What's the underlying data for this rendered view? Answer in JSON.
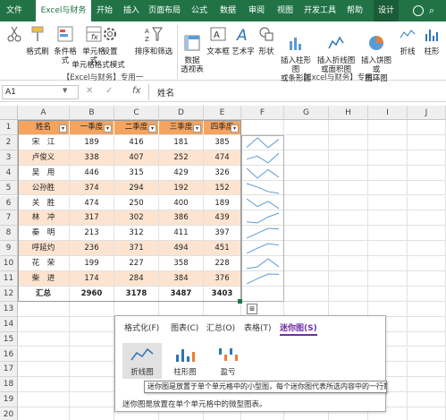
{
  "ribbon": {
    "tabs": [
      "文件",
      "Excel与财务",
      "开始",
      "插入",
      "页面布局",
      "公式",
      "数据",
      "审阅",
      "视图",
      "开发工具",
      "帮助",
      "设计"
    ],
    "active_tab": "Excel与财务",
    "design_tab": "设计",
    "buttons": {
      "format_brush": "格式刷",
      "cond_format": "条件格式",
      "cell_format": "单元格式",
      "settings": "设置",
      "sort_filter": "排序和筛选",
      "pivot": "数据\n透视表",
      "textbox": "文本框",
      "wordart": "艺术字",
      "shapes": "形状",
      "insert_bar": "插入柱形图\n或条形图",
      "insert_line": "插入折线图\n或面积图",
      "insert_pie": "插入饼图或\n圆环图",
      "line": "折线",
      "column": "柱形"
    },
    "group1": "【Excel与财务】专用一",
    "group2": "【Excel与财务】专用二",
    "group_cell_format": "单元格格式模式"
  },
  "formula_bar": {
    "name_box": "A1",
    "fx": "fx",
    "content": "姓名"
  },
  "columns": [
    "A",
    "B",
    "C",
    "D",
    "E",
    "F",
    "G",
    "H",
    "I",
    "J"
  ],
  "rows": [
    "1",
    "2",
    "3",
    "4",
    "5",
    "6",
    "7",
    "8",
    "9",
    "10",
    "11",
    "12",
    "13",
    "14",
    "15",
    "16",
    "17",
    "18",
    "19",
    "20"
  ],
  "table": {
    "headers": [
      "姓名",
      "一季度",
      "二季度",
      "三季度",
      "四季度"
    ],
    "data": [
      [
        "宋　江",
        "189",
        "416",
        "181",
        "385"
      ],
      [
        "卢俊义",
        "338",
        "407",
        "252",
        "474"
      ],
      [
        "吴　用",
        "446",
        "315",
        "429",
        "326"
      ],
      [
        "公孙胜",
        "374",
        "294",
        "192",
        "152"
      ],
      [
        "关　胜",
        "474",
        "250",
        "400",
        "189"
      ],
      [
        "林　冲",
        "317",
        "302",
        "386",
        "439"
      ],
      [
        "秦　明",
        "213",
        "312",
        "411",
        "397"
      ],
      [
        "呼延灼",
        "236",
        "371",
        "494",
        "451"
      ],
      [
        "花　荣",
        "199",
        "227",
        "358",
        "228"
      ],
      [
        "柴　进",
        "174",
        "284",
        "384",
        "376"
      ]
    ],
    "total": [
      "汇总",
      "2960",
      "3178",
      "3487",
      "3403"
    ]
  },
  "quick_analysis": {
    "tabs": [
      "格式化(F)",
      "图表(C)",
      "汇总(O)",
      "表格(T)",
      "迷你图(S)"
    ],
    "active_tab": "迷你图(S)",
    "tiles": [
      "折线图",
      "柱形图",
      "盈亏"
    ],
    "tooltip": "迷你图是放置于单个单元格中的小型图，每个迷你图代表所选内容中的一行数据。",
    "description": "迷你图是放置在单个单元格中的微型图表。"
  },
  "colors": {
    "ribbon_green": "#217346",
    "header_fill": "#f4a460",
    "band_fill": "#fde4d0",
    "accent_purple": "#7030a0"
  }
}
